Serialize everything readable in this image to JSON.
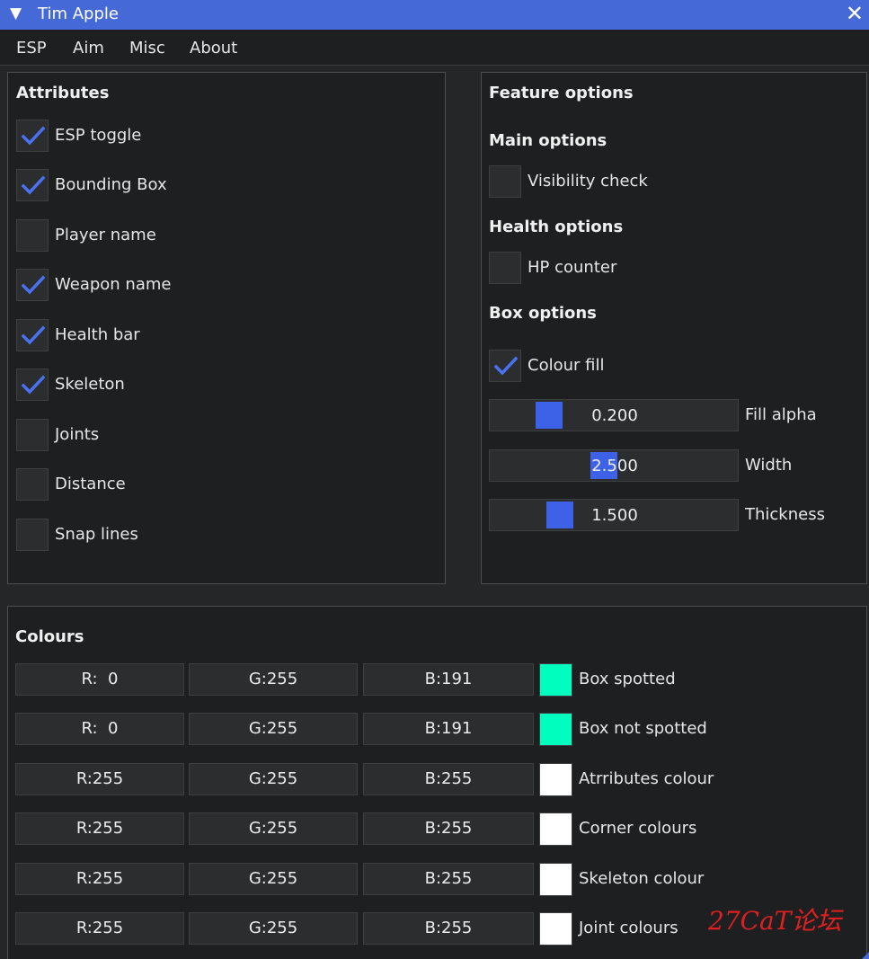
{
  "window": {
    "title": "Tim Apple",
    "collapse_glyph": "▼",
    "close_glyph": "✕"
  },
  "menu": [
    "ESP",
    "Aim",
    "Misc",
    "About"
  ],
  "attributes": {
    "heading": "Attributes",
    "items": [
      {
        "label": "ESP toggle",
        "checked": true
      },
      {
        "label": "Bounding Box",
        "checked": true
      },
      {
        "label": "Player name",
        "checked": false
      },
      {
        "label": "Weapon name",
        "checked": true
      },
      {
        "label": "Health bar",
        "checked": true
      },
      {
        "label": "Skeleton",
        "checked": true
      },
      {
        "label": "Joints",
        "checked": false
      },
      {
        "label": "Distance",
        "checked": false
      },
      {
        "label": "Snap lines",
        "checked": false
      }
    ]
  },
  "feature": {
    "heading": "Feature options",
    "main_heading": "Main options",
    "visibility": {
      "label": "Visibility check",
      "checked": false
    },
    "health_heading": "Health options",
    "hp_counter": {
      "label": "HP counter",
      "checked": false
    },
    "box_heading": "Box options",
    "colour_fill": {
      "label": "Colour fill",
      "checked": true
    },
    "sliders": [
      {
        "value": "0.200",
        "label": "Fill alpha",
        "fraction": 0.2
      },
      {
        "value": "2.500",
        "label": "Width",
        "fraction": 0.45
      },
      {
        "value": "1.500",
        "label": "Thickness",
        "fraction": 0.25
      }
    ]
  },
  "colours": {
    "heading": "Colours",
    "rows": [
      {
        "r": "R:  0",
        "g": "G:255",
        "b": "B:191",
        "swatch": "#00ffbf",
        "label": "Box spotted"
      },
      {
        "r": "R:  0",
        "g": "G:255",
        "b": "B:191",
        "swatch": "#00ffbf",
        "label": "Box not spotted"
      },
      {
        "r": "R:255",
        "g": "G:255",
        "b": "B:255",
        "swatch": "#ffffff",
        "label": "Atrributes colour"
      },
      {
        "r": "R:255",
        "g": "G:255",
        "b": "B:255",
        "swatch": "#ffffff",
        "label": "Corner colours"
      },
      {
        "r": "R:255",
        "g": "G:255",
        "b": "B:255",
        "swatch": "#ffffff",
        "label": "Skeleton colour"
      },
      {
        "r": "R:255",
        "g": "G:255",
        "b": "B:255",
        "swatch": "#ffffff",
        "label": "Joint colours"
      }
    ]
  },
  "theme": {
    "accent": "#4669d8",
    "check": "#4a72f0",
    "grab": "#3d62e8"
  },
  "watermark": "27CaT论坛"
}
